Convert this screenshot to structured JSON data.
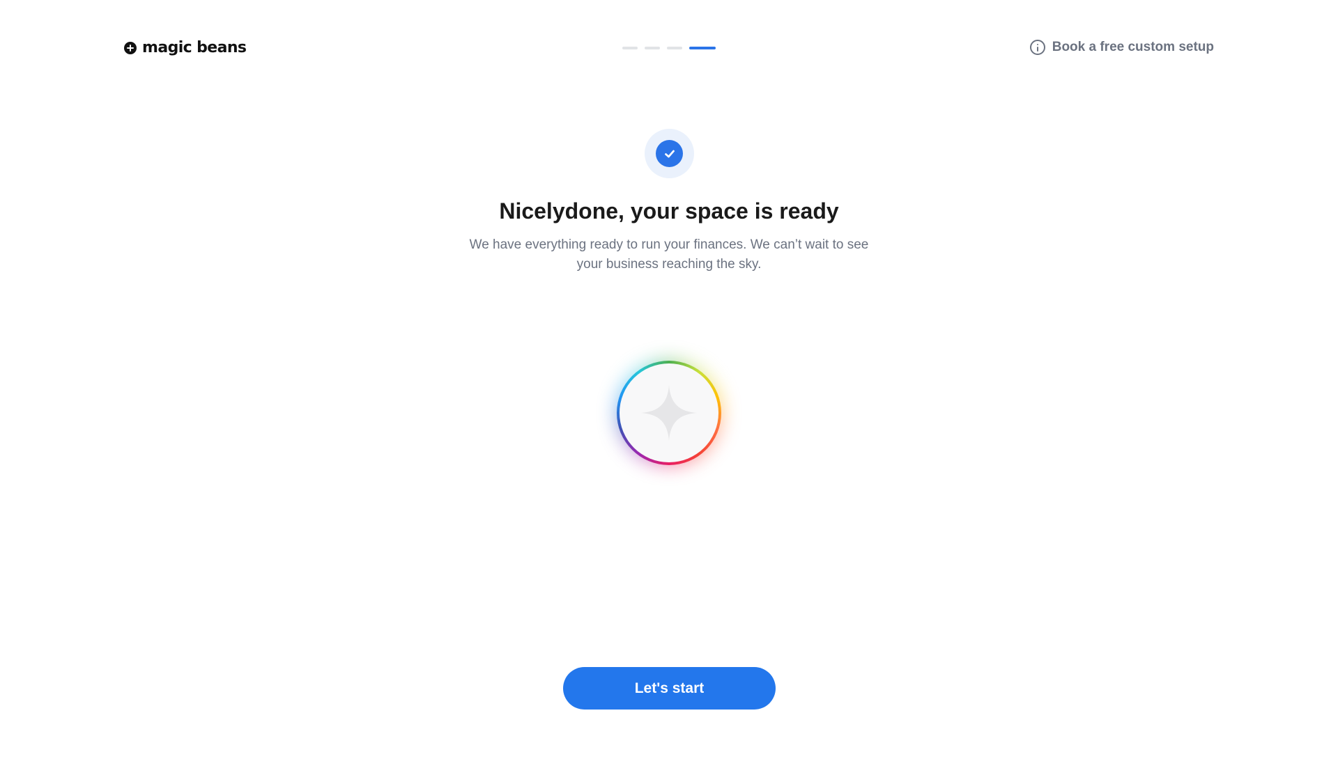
{
  "header": {
    "brand": "magic beans",
    "help_link": "Book a free custom setup",
    "progress": {
      "total_steps": 4,
      "current_step": 4
    }
  },
  "main": {
    "title": "Nicelydone, your space is ready",
    "subtitle": "We have everything ready to run your finances. We can’t wait to see your business reaching the sky.",
    "cta_label": "Let's start"
  },
  "colors": {
    "accent": "#2377ec",
    "text_primary": "#1a1a1a",
    "text_secondary": "#6b7280",
    "progress_inactive": "#e1e3e6"
  },
  "icons": {
    "brand": "plus-circle-icon",
    "help": "info-icon",
    "success": "check-icon",
    "orb": "sparkle-icon"
  }
}
